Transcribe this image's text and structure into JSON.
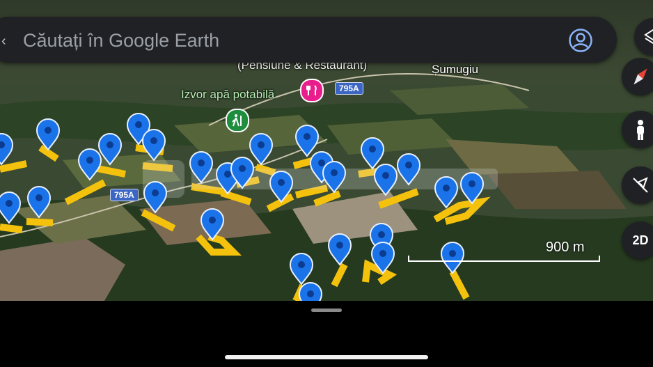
{
  "search": {
    "placeholder": "Căutați în Google Earth"
  },
  "places": {
    "guesthouse": "(Pensiune & Restaurant)",
    "village": "Șumugiu",
    "spring": "Izvor apă potabilă"
  },
  "roads": {
    "label_top": "795A",
    "label_left": "795A"
  },
  "scale": {
    "label": "900 m"
  },
  "controls": {
    "view_mode": "2D"
  },
  "icons": {
    "account": "account-circle-icon",
    "layers": "layers-icon",
    "compass": "compass-icon",
    "street_view": "pegman-icon",
    "location": "location-off-icon"
  },
  "colors": {
    "pin": "#1a73e8",
    "parcel": "#f4c20d",
    "poi_restaurant": "#e91e8c",
    "poi_spring": "#1e8e3e",
    "panel": "#202124"
  }
}
